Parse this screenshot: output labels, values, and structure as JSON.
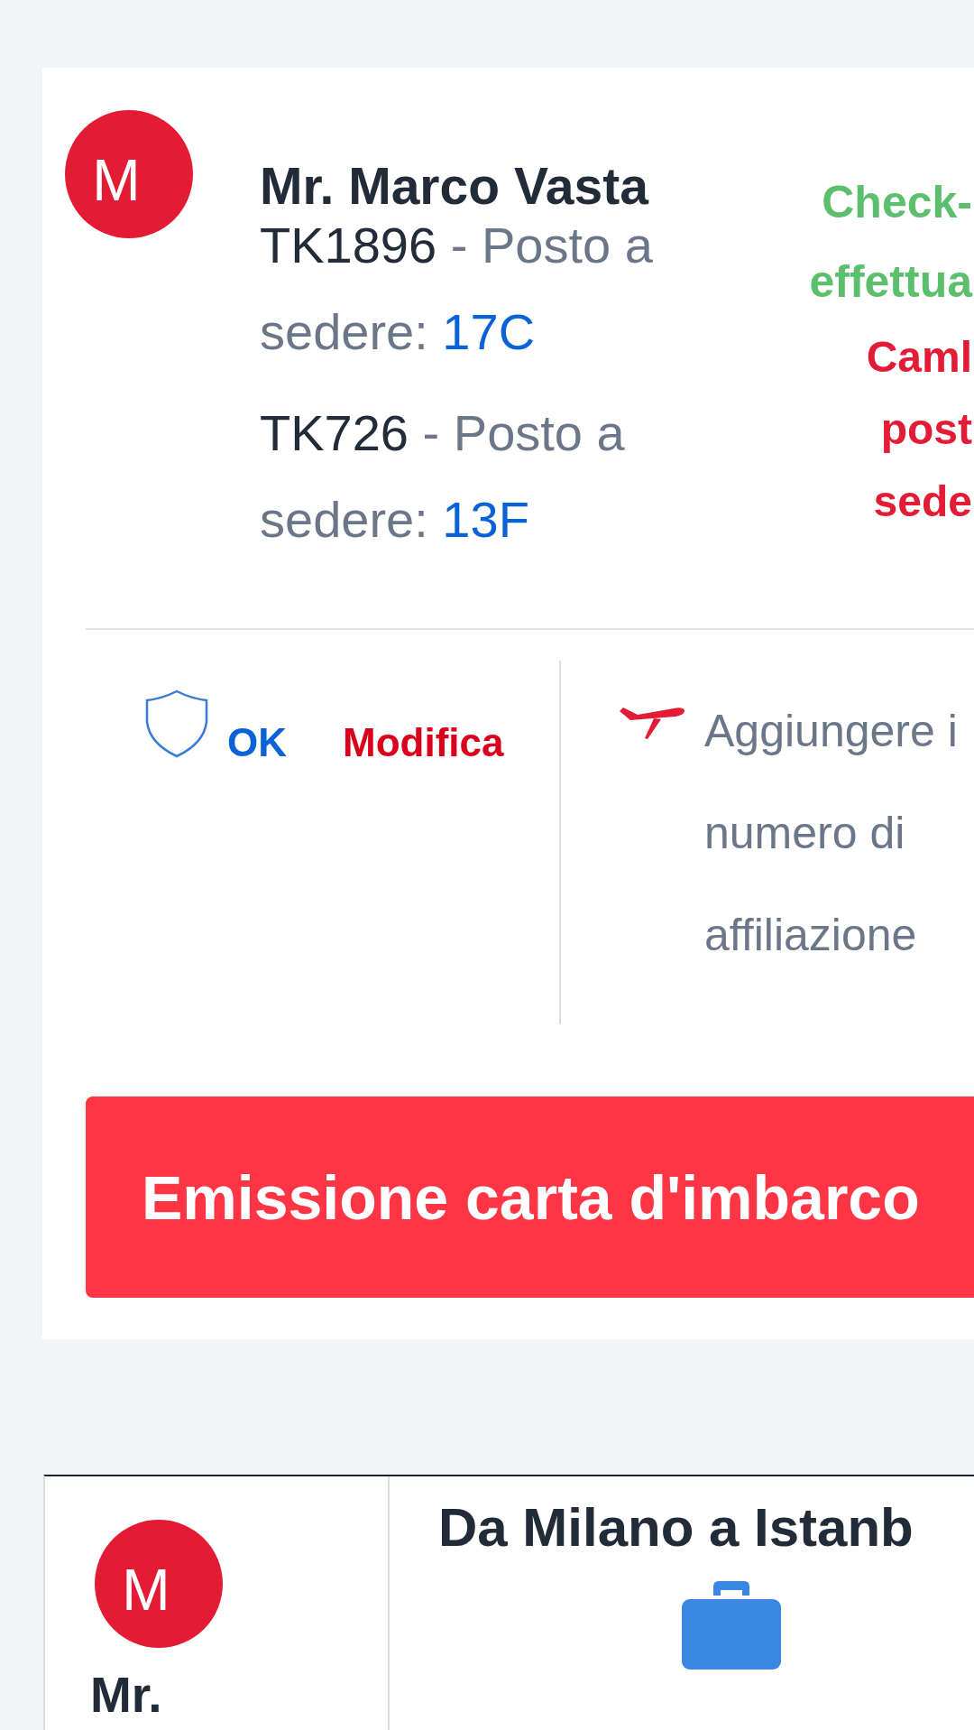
{
  "passenger": {
    "initials": "M",
    "name": "Mr. Marco Vasta",
    "segments": [
      {
        "flight": "TK1896",
        "separator": "-",
        "seat_label": "Posto a sedere:",
        "seat": "17C"
      },
      {
        "flight": "TK726",
        "separator": "-",
        "seat_label": "Posto a sedere:",
        "seat": "13F"
      }
    ],
    "status_lines": [
      "Check-",
      "effettua"
    ],
    "change_seat_lines": [
      "Caml",
      "post",
      "sede"
    ],
    "insurance": {
      "status": "OK",
      "edit": "Modifica"
    },
    "loyalty_lines": [
      "Aggiungere i",
      "numero di",
      "affiliazione"
    ],
    "boarding_button": "Emissione carta d'imbarco"
  },
  "next_passenger": {
    "initials": "M",
    "name": "Mr.",
    "route": "Da Milano a Istanb"
  }
}
